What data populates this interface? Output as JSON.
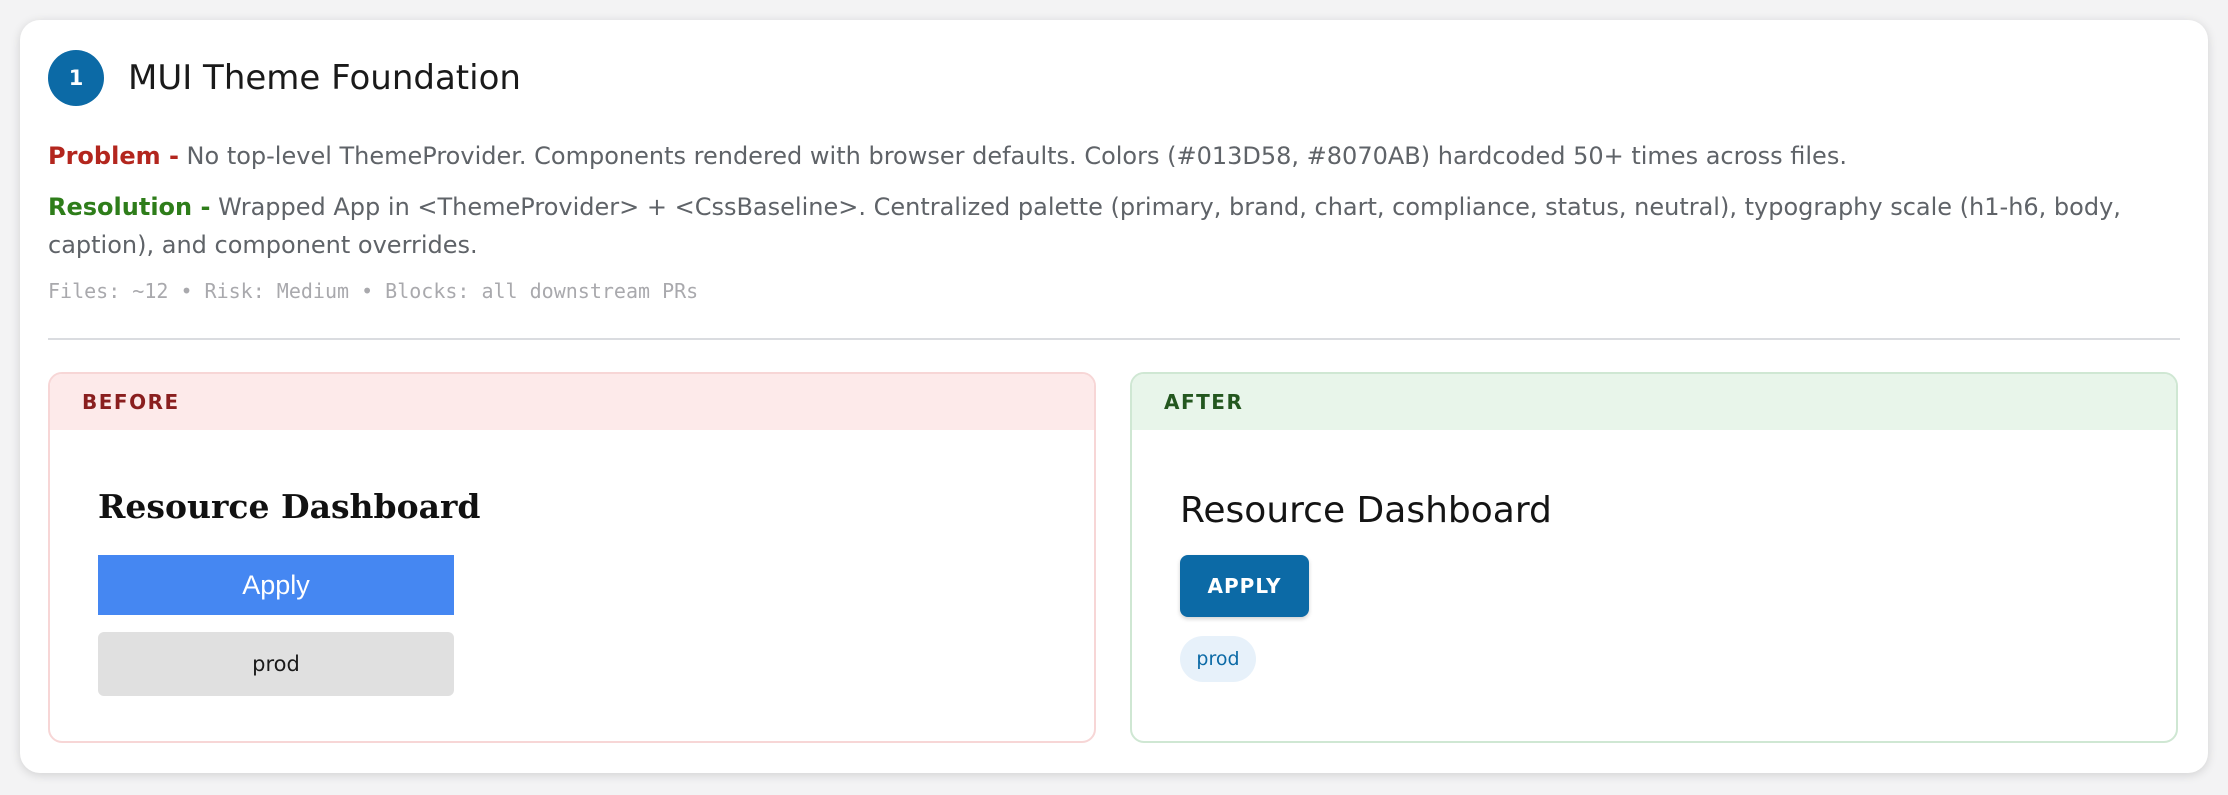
{
  "section": {
    "step_number": "1",
    "title": "MUI Theme Foundation",
    "problem_label": "Problem -",
    "problem_text": " No top-level ThemeProvider. Components rendered with browser defaults. Colors (#013D58, #8070AB) hardcoded 50+ times across files.",
    "resolution_label": "Resolution -",
    "resolution_text": " Wrapped App in <ThemeProvider> + <CssBaseline>. Centralized palette (primary, brand, chart, compliance, status, neutral), typography scale (h1-h6, body, caption), and component overrides.",
    "meta": "Files: ~12 • Risk: Medium • Blocks: all downstream PRs"
  },
  "before": {
    "header": "BEFORE",
    "heading": "Resource Dashboard",
    "button_label": "Apply",
    "chip_label": "prod"
  },
  "after": {
    "header": "AFTER",
    "heading": "Resource Dashboard",
    "button_label": "APPLY",
    "chip_label": "prod"
  },
  "colors": {
    "primary": "#0c6aa6",
    "problem": "#b3261e",
    "resolution": "#2e7d1a",
    "before_header_bg": "#fdeaea",
    "after_header_bg": "#e8f5ea",
    "default_button": "#4587f2"
  }
}
